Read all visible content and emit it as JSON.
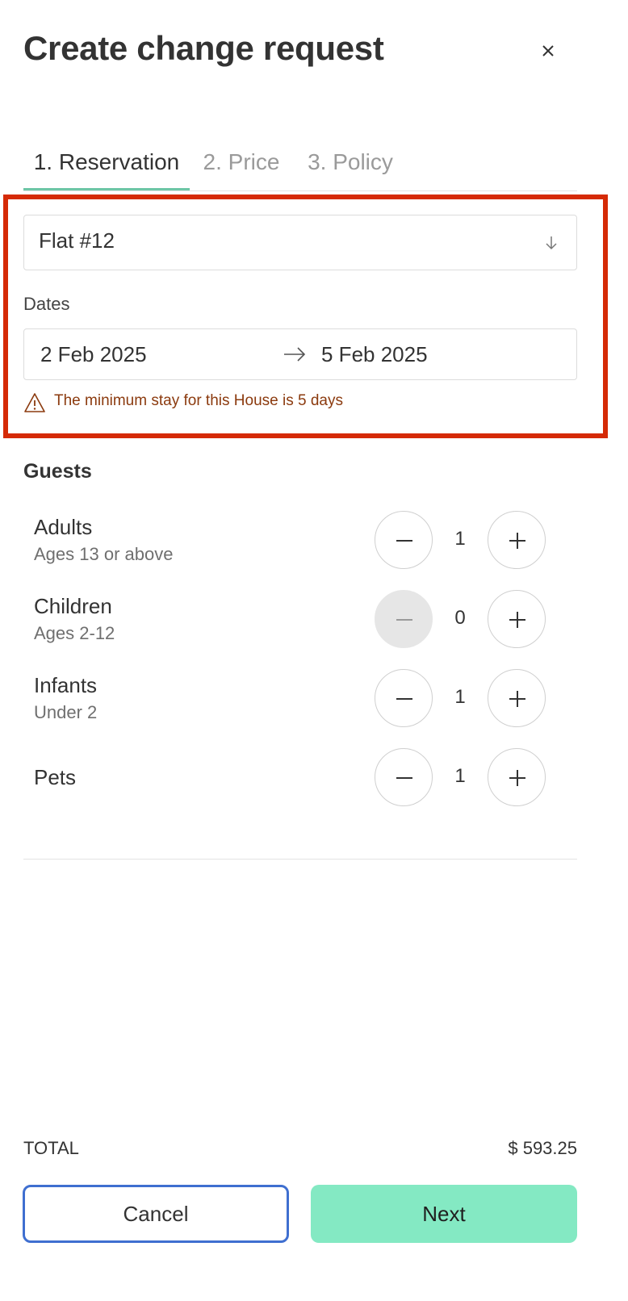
{
  "dialog": {
    "title": "Create change request",
    "close_icon": "close-icon"
  },
  "tabs": [
    {
      "label": "1. Reservation",
      "active": true
    },
    {
      "label": "2. Price",
      "active": false
    },
    {
      "label": "3. Policy",
      "active": false
    }
  ],
  "property_select": {
    "value": "Flat #12",
    "icon": "arrow-down-icon"
  },
  "dates": {
    "label": "Dates",
    "start": "2 Feb 2025",
    "end": "5 Feb 2025",
    "separator_icon": "arrow-right-icon"
  },
  "warning": {
    "text": "The minimum stay for this House is 5 days",
    "icon": "warning-icon",
    "color": "#8b3a0e"
  },
  "guests": {
    "title": "Guests",
    "rows": [
      {
        "label": "Adults",
        "sub": "Ages 13 or above",
        "count": "1",
        "decrement_disabled": false
      },
      {
        "label": "Children",
        "sub": "Ages 2-12",
        "count": "0",
        "decrement_disabled": true
      },
      {
        "label": "Infants",
        "sub": "Under 2",
        "count": "1",
        "decrement_disabled": false
      },
      {
        "label": "Pets",
        "sub": "",
        "count": "1",
        "decrement_disabled": false
      }
    ]
  },
  "footer": {
    "total_label": "TOTAL",
    "total_value": "$ 593.25",
    "cancel_label": "Cancel",
    "next_label": "Next"
  },
  "colors": {
    "accent": "#6ec6a6",
    "next_button": "#84e9c3",
    "cancel_border": "#3f6fd0",
    "highlight_border": "#d52a06"
  }
}
